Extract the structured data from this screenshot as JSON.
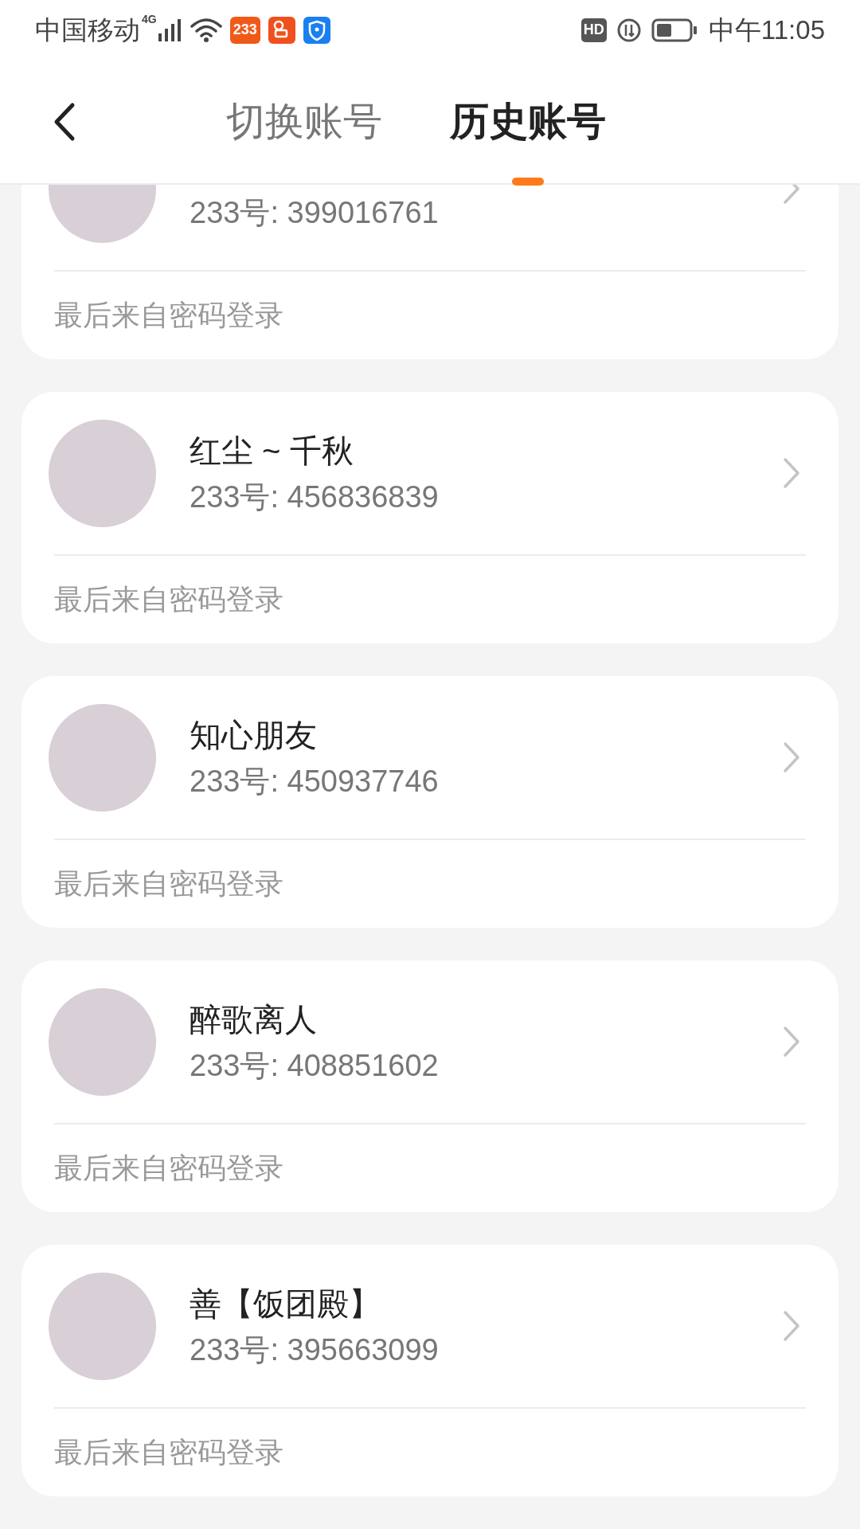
{
  "status_bar": {
    "carrier": "中国移动",
    "network": "4G",
    "app_badge": "233",
    "hd": "HD",
    "time": "中午11:05"
  },
  "header": {
    "tabs": [
      {
        "label": "切换账号",
        "selected": false
      },
      {
        "label": "历史账号",
        "selected": true
      }
    ]
  },
  "accounts": [
    {
      "id_text": "233号: 399016761",
      "last_login": "最后来自密码登录"
    },
    {
      "name": "红尘 ~ 千秋",
      "id_text": "233号: 456836839",
      "last_login": "最后来自密码登录"
    },
    {
      "name": "知心朋友",
      "id_text": "233号: 450937746",
      "last_login": "最后来自密码登录"
    },
    {
      "name": "醉歌离人",
      "id_text": "233号: 408851602",
      "last_login": "最后来自密码登录"
    },
    {
      "name": "善【饭团殿】",
      "id_text": "233号: 395663099",
      "last_login": "最后来自密码登录"
    }
  ]
}
